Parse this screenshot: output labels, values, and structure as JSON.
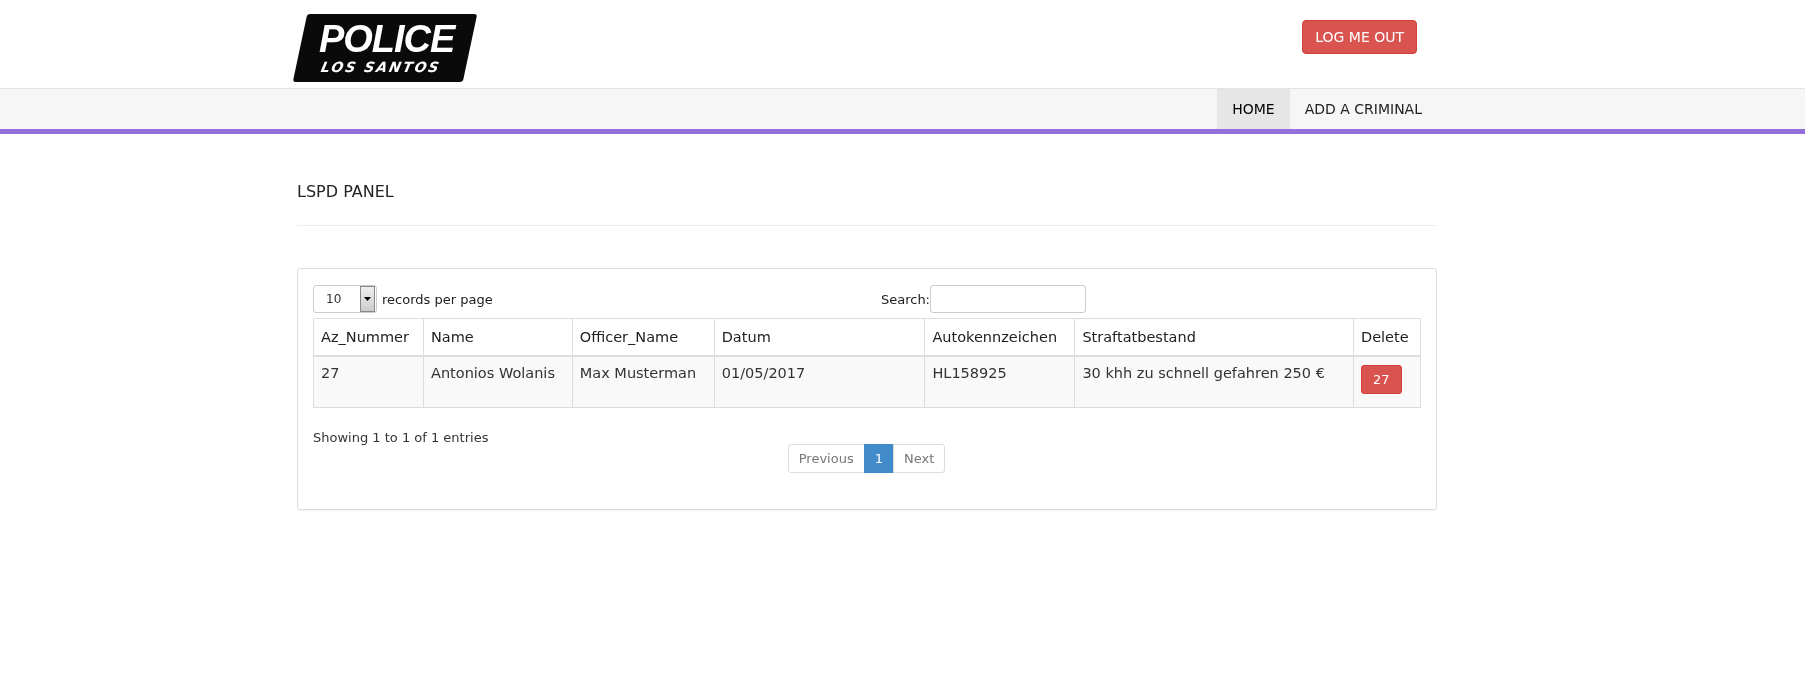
{
  "header": {
    "logo": {
      "title": "POLICE",
      "subtitle": "LOS SANTOS"
    },
    "logout_button": "LOG ME OUT"
  },
  "nav": [
    {
      "label": "HOME",
      "selected": true
    },
    {
      "label": "ADD A CRIMINAL",
      "selected": false
    }
  ],
  "page_title": "LSPD PANEL",
  "table_panel": {
    "page_size": {
      "value": "10",
      "label": "records per page"
    },
    "search": {
      "label": "Search:"
    },
    "columns": [
      "Az_Nummer",
      "Name",
      "Officer_Name",
      "Datum",
      "Autokennzeichen",
      "Straftatbestand",
      "Delete"
    ],
    "rows": [
      {
        "cells": [
          "27",
          "Antonios Wolanis",
          "Max Musterman",
          "01/05/2017",
          "HL158925",
          "30 khh zu schnell gefahren 250 €"
        ],
        "delete_button": "27"
      }
    ],
    "info": "Showing 1 to 1 of 1 entries",
    "pagination": [
      {
        "label": "Previous",
        "selected": false
      },
      {
        "label": "1",
        "selected": true
      },
      {
        "label": "Next",
        "selected": false
      }
    ]
  }
}
